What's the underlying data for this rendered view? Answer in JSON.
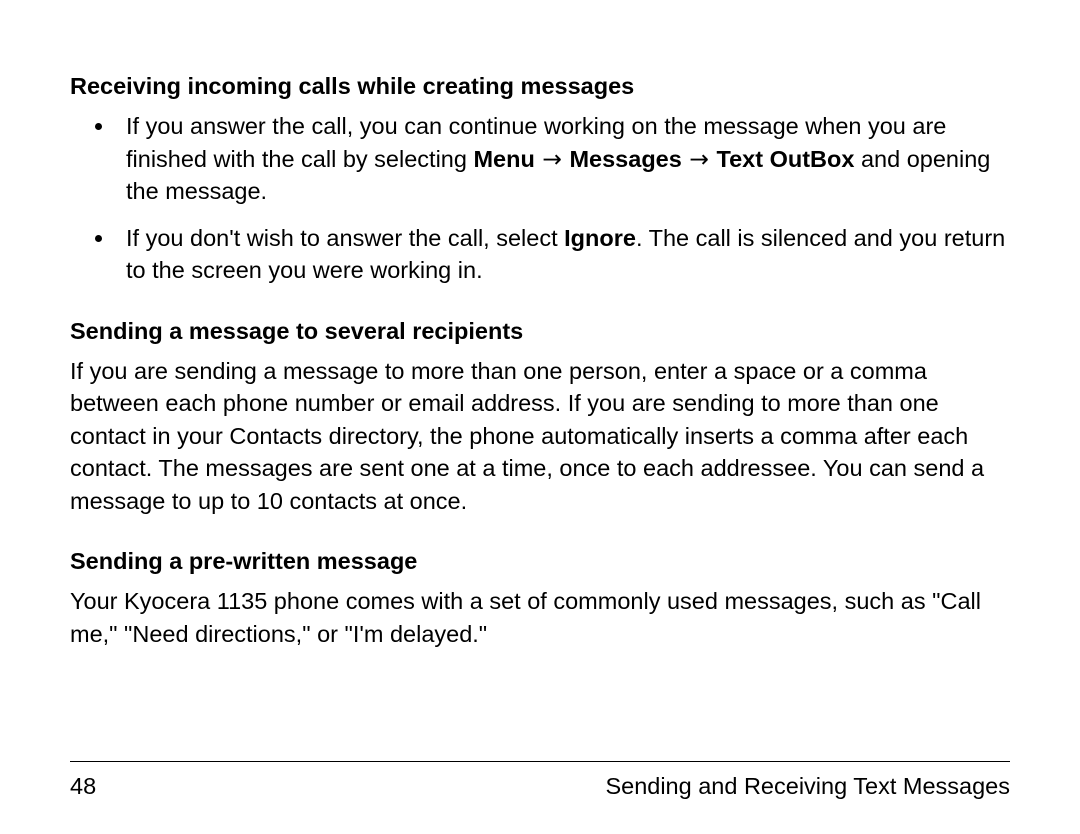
{
  "section1": {
    "heading": "Receiving incoming calls while creating messages",
    "bullet1_a": "If you answer the call, you can continue working on the message when you are finished with the call by selecting ",
    "bullet1_menu": "Menu",
    "bullet1_arrow1": " → ",
    "bullet1_messages": "Messages",
    "bullet1_arrow2": " → ",
    "bullet1_outbox": "Text OutBox",
    "bullet1_b": " and opening the message.",
    "bullet2_a": "If you don't wish to answer the call, select ",
    "bullet2_ignore": "Ignore",
    "bullet2_b": ". The call is silenced and you return to the screen you were working in."
  },
  "section2": {
    "heading": "Sending a message to several recipients",
    "para": "If you are sending a message to more than one person, enter a space or a comma between each phone number or email address. If you are sending to more than one contact in your Contacts directory, the phone automatically inserts a comma after each contact. The messages are sent one at a time, once to each addressee. You can send a message to up to 10 contacts at once."
  },
  "section3": {
    "heading": "Sending a pre-written message",
    "para": "Your Kyocera 1135 phone comes with a set of commonly used messages, such as \"Call me,\" \"Need directions,\" or \"I'm delayed.\""
  },
  "footer": {
    "page": "48",
    "title": "Sending and Receiving Text Messages"
  }
}
